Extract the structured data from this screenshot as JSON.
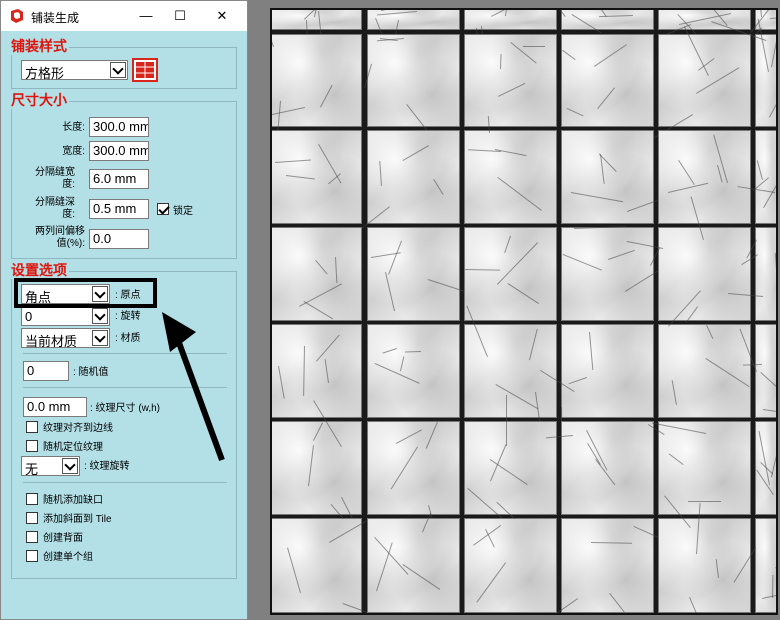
{
  "window": {
    "title": "铺装生成",
    "minimize": "—",
    "maximize": "☐",
    "close": "✕"
  },
  "pattern_group": {
    "title": "铺装样式",
    "style_value": "方格形",
    "icon": "grid-pattern-icon"
  },
  "size_group": {
    "title": "尺寸大小",
    "length_label": "长度:",
    "length_value": "300.0 mm",
    "width_label": "宽度:",
    "width_value": "300.0 mm",
    "gap_width_label_1": "分隔缝宽",
    "gap_width_label_2": "度:",
    "gap_width_value": "6.0 mm",
    "gap_depth_label_1": "分隔缝深",
    "gap_depth_label_2": "度:",
    "gap_depth_value": "0.5 mm",
    "lock_label": "锁定",
    "lock_checked": true,
    "offset_label_1": "两列间偏移",
    "offset_label_2": "值(%):",
    "offset_value": "0.0"
  },
  "settings_group": {
    "title": "设置选项",
    "origin_value": "角点",
    "origin_label": ": 原点",
    "rotation_value": "0",
    "rotation_label": ": 旋转",
    "material_value": "当前材质",
    "material_label": ": 材质",
    "random_value": "0",
    "random_label": ": 随机值",
    "texture_size_value": "0.0 mm",
    "texture_size_label": ": 纹理尺寸 (w,h)",
    "align_texture_label": "纹理对齐到边线",
    "random_texture_label": "随机定位纹理",
    "texture_rotation_value": "无",
    "texture_rotation_label": ": 纹理旋转",
    "random_gap_label": "随机添加缺口",
    "add_bevel_label": "添加斜面到 Tile",
    "create_back_label": "创建背面",
    "create_single_group_label": "创建单个组"
  },
  "colors": {
    "dialog_bg": "#b3dfe6",
    "group_title": "#e0140c",
    "viewport_bg": "#808080"
  }
}
